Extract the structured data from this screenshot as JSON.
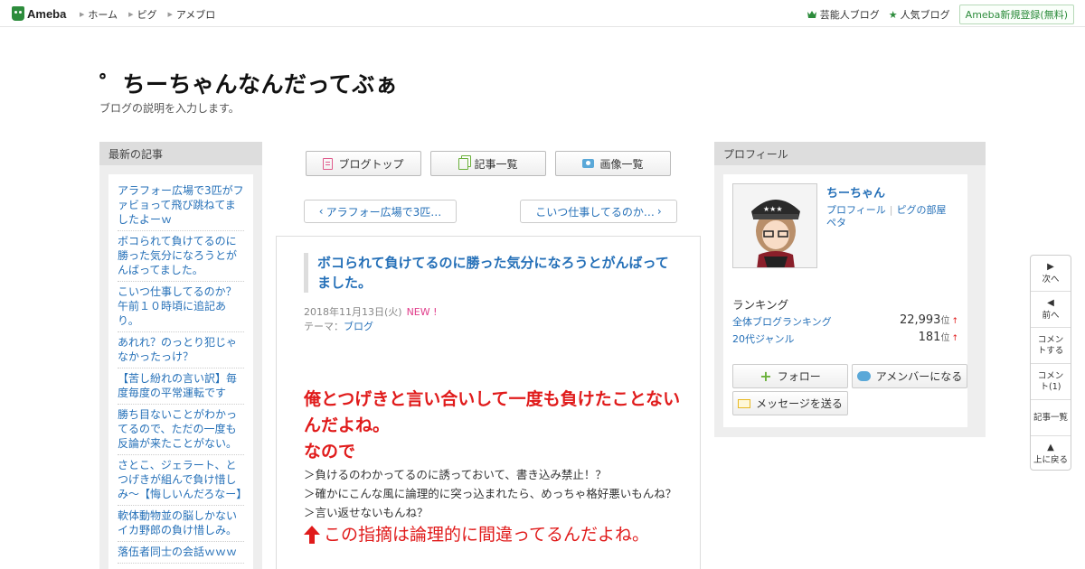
{
  "topbar": {
    "logo_text": "Ameba",
    "nav": [
      "ホーム",
      "ピグ",
      "アメブロ"
    ],
    "celebrity_blog": "芸能人ブログ",
    "popular_blog": "人気ブログ",
    "register": "Ameba新規登録(無料)"
  },
  "header": {
    "title": "゜ちーちゃんなんだってぶぁ",
    "description": "ブログの説明を入力します。"
  },
  "latest": {
    "heading": "最新の記事",
    "items": [
      "アラフォー広場で3匹がファビョって飛び跳ねてましたよーｗ",
      "ボコられて負けてるのに勝った気分になろうとがんばってました。",
      "こいつ仕事してるのか？　午前１０時頃に追記あり。",
      "あれれ？のっとり犯じゃなかったっけ？",
      "【苦し紛れの言い訳】毎度毎度の平常運転です",
      "勝ち目ないことがわかってるので、ただの一度も反論が来たことがない。",
      "さとこ、ジェラート、とつげきが組んで負け惜しみ～【悔しいんだろなー】",
      "軟体動物並の脳しかないイカ野郎の負け惜しみ。",
      "落伍者同士の会話ｗｗｗ"
    ]
  },
  "tabs": {
    "top": "ブログトップ",
    "list": "記事一覧",
    "images": "画像一覧"
  },
  "pager": {
    "prev": "アラフォー広場で3匹…",
    "next": "こいつ仕事してるのか…"
  },
  "article": {
    "title": "ボコられて負けてるのに勝った気分になろうとがんばってました。",
    "date": "2018年11月13日(火)",
    "new_badge": "NEW !",
    "theme_label": "テーマ：",
    "theme": "ブログ",
    "red_line1": "俺とつげきと言い合いして一度も負けたことないんだよね。",
    "red_line2": "なので",
    "quote1": "＞負けるのわかってるのに誘っておいて、書き込み禁止！？",
    "quote2": "＞確かにこんな風に論理的に突っ込まれたら、めっちゃ格好悪いもんね？",
    "quote3": "＞言い返せないもんね？",
    "red_line3": "この指摘は論理的に間違ってるんだよね。"
  },
  "profile": {
    "heading": "プロフィール",
    "name": "ちーちゃん",
    "link_profile": "プロフィール",
    "link_pig": "ピグの部屋",
    "link_peta": "ペタ",
    "ranking_heading": "ランキング",
    "rank_all_label": "全体ブログランキング",
    "rank_all_value": "22,993",
    "rank_genre_label": "20代ジャンル",
    "rank_genre_value": "181",
    "rank_unit": "位",
    "follow": "フォロー",
    "amember": "アメンバーになる",
    "message": "メッセージを送る"
  },
  "sidenav": {
    "next": "次へ",
    "prev": "前へ",
    "comment_write": "コメントする",
    "comments": "コメント(1)",
    "list": "記事一覧",
    "top": "上に戻る"
  }
}
